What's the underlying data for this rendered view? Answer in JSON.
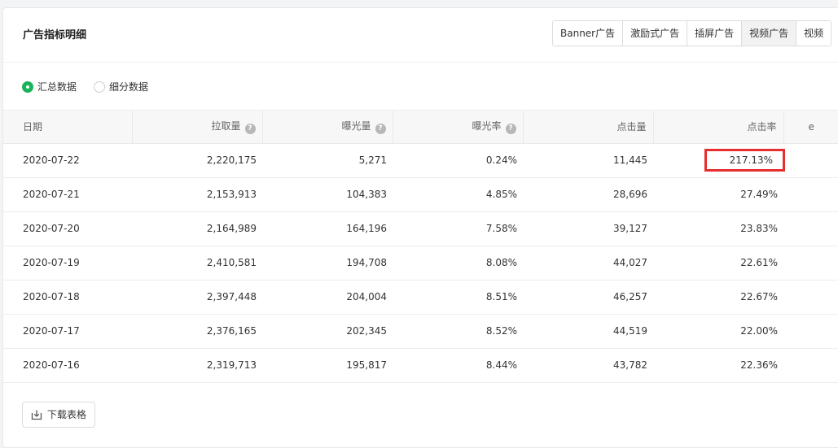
{
  "card": {
    "title": "广告指标明细"
  },
  "tabs": [
    {
      "label": "Banner广告",
      "active": false
    },
    {
      "label": "激励式广告",
      "active": false
    },
    {
      "label": "插屏广告",
      "active": false
    },
    {
      "label": "视频广告",
      "active": true
    },
    {
      "label": "视频",
      "active": false
    }
  ],
  "view_mode": {
    "options": [
      {
        "label": "汇总数据",
        "checked": true
      },
      {
        "label": "细分数据",
        "checked": false
      }
    ]
  },
  "table": {
    "columns": [
      {
        "label": "日期",
        "help": false
      },
      {
        "label": "拉取量",
        "help": true
      },
      {
        "label": "曝光量",
        "help": true
      },
      {
        "label": "曝光率",
        "help": true
      },
      {
        "label": "点击量",
        "help": false
      },
      {
        "label": "点击率",
        "help": false
      },
      {
        "label": "e",
        "help": false
      }
    ],
    "rows": [
      [
        "2020-07-22",
        "2,220,175",
        "5,271",
        "0.24%",
        "11,445",
        "217.13%",
        ""
      ],
      [
        "2020-07-21",
        "2,153,913",
        "104,383",
        "4.85%",
        "28,696",
        "27.49%",
        ""
      ],
      [
        "2020-07-20",
        "2,164,989",
        "164,196",
        "7.58%",
        "39,127",
        "23.83%",
        ""
      ],
      [
        "2020-07-19",
        "2,410,581",
        "194,708",
        "8.08%",
        "44,027",
        "22.61%",
        ""
      ],
      [
        "2020-07-18",
        "2,397,448",
        "204,004",
        "8.51%",
        "46,257",
        "22.67%",
        ""
      ],
      [
        "2020-07-17",
        "2,376,165",
        "202,345",
        "8.52%",
        "44,519",
        "22.00%",
        ""
      ],
      [
        "2020-07-16",
        "2,319,713",
        "195,817",
        "8.44%",
        "43,782",
        "22.36%",
        ""
      ]
    ],
    "help_glyph": "?"
  },
  "footer": {
    "download_label": "下载表格"
  },
  "colors": {
    "radio_checked": "#19b35c",
    "highlight_border": "#e52e2e"
  }
}
